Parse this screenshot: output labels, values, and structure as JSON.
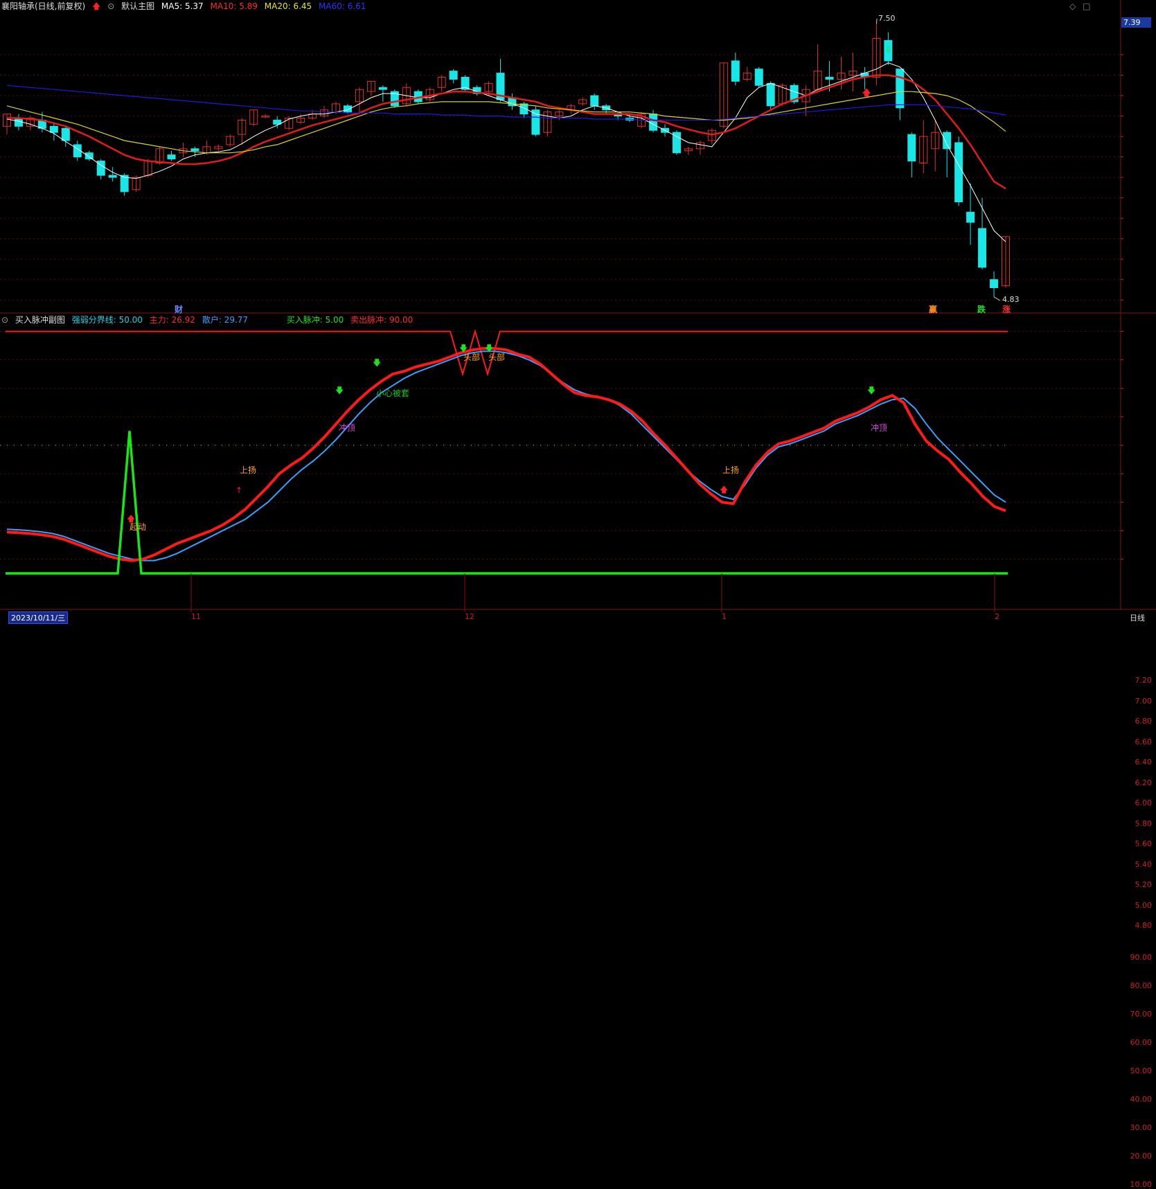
{
  "header_main": {
    "stock_title": "襄阳轴承(日线,前复权)",
    "indicator_name": "默认主图",
    "ma5": "MA5: 5.37",
    "ma10": "MA10: 5.89",
    "ma20": "MA20: 6.45",
    "ma60": "MA60: 6.61"
  },
  "header_sub": {
    "indicator_name": "买入脉冲副图",
    "divider_line": "强弱分界线: 50.00",
    "main_force": "主力: 26.92",
    "retail": "散户: 29.77",
    "buy_pulse": "买入脉冲: 5.00",
    "sell_pulse": "卖出脉冲: 90.00"
  },
  "price_axis": [
    "7.20",
    "7.00",
    "6.80",
    "6.60",
    "6.40",
    "6.20",
    "6.00",
    "5.80",
    "5.60",
    "5.40",
    "5.20",
    "5.00",
    "4.80"
  ],
  "osc_axis": [
    "90.00",
    "80.00",
    "70.00",
    "60.00",
    "50.00",
    "40.00",
    "30.00",
    "20.00",
    "10.00"
  ],
  "current_price_tag": "7.39",
  "high_label": "7.50",
  "low_label": "4.83",
  "markers": {
    "cai": "财",
    "ying": "赢",
    "die": "跌",
    "zhang": "涨"
  },
  "annotations": {
    "qidong": "起动",
    "shangyang1": "上扬",
    "chongding1": "冲顶",
    "xiaoxin": "小心被套",
    "toubu1": "头部",
    "toubu2": "头部",
    "shangyang2": "上扬",
    "chongding2": "冲顶"
  },
  "date_axis": {
    "start_date": "2023/10/11/三",
    "m11": "11",
    "m12": "12",
    "m1": "1",
    "m2": "2",
    "period": "日线"
  },
  "colors": {
    "ma5": "#ffffff",
    "ma10": "#e21b1b",
    "ma20": "#d8d81a",
    "ma60": "#1a1ae6",
    "up": "#e03030",
    "down": "#19e6e6",
    "main_force": "#ff1a1a",
    "retail": "#3aa0ff",
    "pulse": "#19e619"
  },
  "chart_data": {
    "type": "candlestick",
    "ylim": [
      4.7,
      7.6
    ],
    "candles": [
      [
        6.5,
        6.62,
        6.62,
        6.42
      ],
      [
        6.58,
        6.5,
        6.62,
        6.46
      ],
      [
        6.5,
        6.58,
        6.6,
        6.46
      ],
      [
        6.56,
        6.48,
        6.64,
        6.44
      ],
      [
        6.5,
        6.44,
        6.54,
        6.36
      ],
      [
        6.48,
        6.36,
        6.5,
        6.3
      ],
      [
        6.32,
        6.2,
        6.36,
        6.16
      ],
      [
        6.24,
        6.18,
        6.26,
        6.16
      ],
      [
        6.16,
        6.02,
        6.18,
        5.98
      ],
      [
        6.02,
        6.0,
        6.1,
        5.96
      ],
      [
        6.02,
        5.86,
        6.04,
        5.82
      ],
      [
        5.88,
        6.0,
        6.02,
        5.86
      ],
      [
        6.02,
        6.16,
        6.18,
        6.0
      ],
      [
        6.14,
        6.28,
        6.3,
        6.12
      ],
      [
        6.22,
        6.18,
        6.26,
        6.16
      ],
      [
        6.24,
        6.28,
        6.34,
        6.2
      ],
      [
        6.28,
        6.26,
        6.3,
        6.2
      ],
      [
        6.24,
        6.3,
        6.36,
        6.22
      ],
      [
        6.28,
        6.3,
        6.32,
        6.26
      ],
      [
        6.32,
        6.4,
        6.42,
        6.3
      ],
      [
        6.42,
        6.56,
        6.58,
        6.32
      ],
      [
        6.52,
        6.66,
        6.66,
        6.5
      ],
      [
        6.6,
        6.6,
        6.62,
        6.58
      ],
      [
        6.56,
        6.52,
        6.6,
        6.48
      ],
      [
        6.48,
        6.58,
        6.6,
        6.46
      ],
      [
        6.54,
        6.58,
        6.62,
        6.52
      ],
      [
        6.58,
        6.62,
        6.66,
        6.56
      ],
      [
        6.6,
        6.66,
        6.7,
        6.58
      ],
      [
        6.64,
        6.72,
        6.74,
        6.62
      ],
      [
        6.7,
        6.64,
        6.72,
        6.62
      ],
      [
        6.74,
        6.86,
        6.88,
        6.62
      ],
      [
        6.84,
        6.94,
        6.94,
        6.8
      ],
      [
        6.88,
        6.86,
        6.9,
        6.74
      ],
      [
        6.84,
        6.7,
        6.86,
        6.68
      ],
      [
        6.72,
        6.88,
        6.92,
        6.7
      ],
      [
        6.84,
        6.74,
        6.86,
        6.72
      ],
      [
        6.76,
        6.86,
        6.88,
        6.74
      ],
      [
        6.88,
        6.98,
        7.0,
        6.84
      ],
      [
        7.04,
        6.96,
        7.06,
        6.92
      ],
      [
        6.98,
        6.86,
        7.0,
        6.84
      ],
      [
        6.88,
        6.82,
        6.9,
        6.8
      ],
      [
        6.84,
        6.92,
        6.94,
        6.8
      ],
      [
        7.02,
        6.76,
        7.16,
        6.74
      ],
      [
        6.78,
        6.7,
        6.82,
        6.66
      ],
      [
        6.72,
        6.62,
        6.74,
        6.58
      ],
      [
        6.66,
        6.42,
        6.7,
        6.4
      ],
      [
        6.44,
        6.64,
        6.66,
        6.4
      ],
      [
        6.6,
        6.64,
        6.66,
        6.56
      ],
      [
        6.66,
        6.7,
        6.72,
        6.62
      ],
      [
        6.72,
        6.76,
        6.78,
        6.7
      ],
      [
        6.8,
        6.7,
        6.82,
        6.66
      ],
      [
        6.7,
        6.66,
        6.72,
        6.62
      ],
      [
        6.62,
        6.6,
        6.64,
        6.56
      ],
      [
        6.58,
        6.56,
        6.62,
        6.54
      ],
      [
        6.5,
        6.62,
        6.64,
        6.48
      ],
      [
        6.62,
        6.46,
        6.66,
        6.44
      ],
      [
        6.48,
        6.44,
        6.52,
        6.4
      ],
      [
        6.44,
        6.24,
        6.46,
        6.22
      ],
      [
        6.26,
        6.28,
        6.3,
        6.22
      ],
      [
        6.28,
        6.34,
        6.36,
        6.22
      ],
      [
        6.36,
        6.46,
        6.48,
        6.32
      ],
      [
        6.5,
        7.12,
        7.12,
        6.48
      ],
      [
        7.14,
        6.94,
        7.22,
        6.9
      ],
      [
        6.96,
        7.02,
        7.08,
        6.94
      ],
      [
        7.06,
        6.9,
        7.08,
        6.88
      ],
      [
        6.92,
        6.7,
        6.94,
        6.66
      ],
      [
        6.72,
        6.9,
        6.92,
        6.7
      ],
      [
        6.9,
        6.74,
        6.92,
        6.72
      ],
      [
        6.74,
        6.86,
        6.9,
        6.6
      ],
      [
        6.86,
        7.04,
        7.3,
        6.84
      ],
      [
        6.98,
        6.96,
        7.14,
        6.84
      ],
      [
        6.96,
        7.02,
        7.18,
        6.86
      ],
      [
        7.0,
        7.04,
        7.22,
        6.84
      ],
      [
        7.02,
        6.98,
        7.08,
        6.86
      ],
      [
        6.98,
        7.36,
        7.5,
        6.9
      ],
      [
        7.34,
        7.14,
        7.42,
        7.1
      ],
      [
        7.06,
        6.68,
        7.06,
        6.56
      ],
      [
        6.42,
        6.16,
        6.44,
        6.0
      ],
      [
        6.14,
        6.4,
        6.56,
        6.04
      ],
      [
        6.28,
        6.44,
        6.56,
        6.06
      ],
      [
        6.44,
        6.28,
        6.46,
        6.0
      ],
      [
        6.34,
        5.76,
        6.4,
        5.72
      ],
      [
        5.66,
        5.56,
        5.94,
        5.34
      ],
      [
        5.5,
        5.12,
        5.8,
        5.1
      ],
      [
        5.0,
        4.92,
        5.08,
        4.83
      ],
      [
        4.94,
        5.42,
        5.42,
        4.92
      ]
    ],
    "ma_series": [
      {
        "name": "MA5",
        "values": [
          6.57,
          6.55,
          6.52,
          6.48,
          6.43,
          6.35,
          6.28,
          6.2,
          6.12,
          6.05,
          6.0,
          5.99,
          6.02,
          6.06,
          6.11,
          6.18,
          6.22,
          6.24,
          6.25,
          6.27,
          6.33,
          6.4,
          6.46,
          6.51,
          6.57,
          6.6,
          6.62,
          6.62,
          6.64,
          6.66,
          6.72,
          6.78,
          6.82,
          6.82,
          6.8,
          6.78,
          6.78,
          6.82,
          6.86,
          6.88,
          6.84,
          6.8,
          6.76,
          6.72,
          6.68,
          6.62,
          6.6,
          6.58,
          6.6,
          6.66,
          6.7,
          6.68,
          6.64,
          6.6,
          6.58,
          6.52,
          6.46,
          6.4,
          6.34,
          6.32,
          6.3,
          6.44,
          6.58,
          6.78,
          6.88,
          6.92,
          6.88,
          6.84,
          6.8,
          6.86,
          6.9,
          6.94,
          6.98,
          7.02,
          7.06,
          7.12,
          7.08,
          6.96,
          6.78,
          6.56,
          6.32,
          6.12,
          5.92,
          5.7,
          5.48,
          5.37
        ]
      },
      {
        "name": "MA10",
        "values": [
          6.58,
          6.58,
          6.57,
          6.56,
          6.53,
          6.5,
          6.45,
          6.4,
          6.34,
          6.28,
          6.22,
          6.18,
          6.16,
          6.15,
          6.14,
          6.13,
          6.13,
          6.14,
          6.16,
          6.19,
          6.24,
          6.3,
          6.35,
          6.39,
          6.43,
          6.47,
          6.51,
          6.54,
          6.57,
          6.6,
          6.63,
          6.68,
          6.72,
          6.74,
          6.76,
          6.78,
          6.8,
          6.82,
          6.84,
          6.84,
          6.83,
          6.82,
          6.8,
          6.78,
          6.76,
          6.74,
          6.7,
          6.68,
          6.66,
          6.64,
          6.62,
          6.62,
          6.62,
          6.62,
          6.6,
          6.56,
          6.54,
          6.5,
          6.47,
          6.44,
          6.42,
          6.44,
          6.48,
          6.54,
          6.6,
          6.66,
          6.72,
          6.76,
          6.8,
          6.84,
          6.88,
          6.92,
          6.96,
          6.98,
          7.0,
          7.0,
          6.98,
          6.94,
          6.86,
          6.76,
          6.62,
          6.48,
          6.32,
          6.14,
          5.96,
          5.89
        ]
      },
      {
        "name": "MA20",
        "values": [
          6.7,
          6.67,
          6.64,
          6.61,
          6.58,
          6.55,
          6.52,
          6.48,
          6.44,
          6.4,
          6.36,
          6.34,
          6.32,
          6.3,
          6.28,
          6.26,
          6.25,
          6.24,
          6.24,
          6.24,
          6.25,
          6.27,
          6.3,
          6.32,
          6.36,
          6.4,
          6.44,
          6.48,
          6.52,
          6.56,
          6.6,
          6.64,
          6.67,
          6.69,
          6.7,
          6.72,
          6.73,
          6.74,
          6.74,
          6.74,
          6.74,
          6.74,
          6.73,
          6.72,
          6.71,
          6.7,
          6.68,
          6.67,
          6.66,
          6.65,
          6.64,
          6.64,
          6.64,
          6.64,
          6.63,
          6.62,
          6.6,
          6.59,
          6.58,
          6.57,
          6.56,
          6.56,
          6.57,
          6.58,
          6.6,
          6.62,
          6.64,
          6.66,
          6.68,
          6.7,
          6.72,
          6.74,
          6.76,
          6.78,
          6.8,
          6.82,
          6.84,
          6.84,
          6.83,
          6.82,
          6.8,
          6.76,
          6.7,
          6.62,
          6.54,
          6.45
        ]
      },
      {
        "name": "MA60",
        "values": [
          6.9,
          6.89,
          6.88,
          6.87,
          6.86,
          6.85,
          6.84,
          6.83,
          6.82,
          6.81,
          6.8,
          6.79,
          6.78,
          6.77,
          6.76,
          6.75,
          6.74,
          6.73,
          6.72,
          6.71,
          6.7,
          6.69,
          6.68,
          6.67,
          6.66,
          6.65,
          6.65,
          6.64,
          6.64,
          6.63,
          6.63,
          6.63,
          6.63,
          6.62,
          6.62,
          6.62,
          6.62,
          6.61,
          6.61,
          6.61,
          6.6,
          6.6,
          6.6,
          6.59,
          6.59,
          6.59,
          6.58,
          6.58,
          6.58,
          6.58,
          6.57,
          6.57,
          6.57,
          6.57,
          6.56,
          6.56,
          6.56,
          6.56,
          6.56,
          6.56,
          6.56,
          6.57,
          6.58,
          6.59,
          6.6,
          6.61,
          6.62,
          6.63,
          6.64,
          6.65,
          6.66,
          6.67,
          6.68,
          6.69,
          6.7,
          6.71,
          6.71,
          6.71,
          6.71,
          6.7,
          6.69,
          6.68,
          6.67,
          6.65,
          6.63,
          6.61
        ]
      }
    ],
    "oscillator": {
      "ylim": [
        5,
        95
      ],
      "main_force": [
        19.5,
        19.3,
        19.0,
        18.6,
        18.0,
        17.0,
        15.5,
        14.0,
        12.5,
        11.0,
        10.0,
        9.5,
        10.0,
        11.5,
        13.5,
        15.5,
        17.0,
        18.5,
        20.0,
        22.0,
        24.5,
        27.5,
        31.5,
        35.5,
        40.0,
        43.0,
        45.5,
        49.0,
        53.0,
        57.5,
        62.0,
        66.0,
        69.5,
        72.5,
        75.0,
        76.0,
        77.5,
        78.5,
        79.5,
        81.0,
        82.5,
        83.5,
        84.0,
        84.0,
        83.5,
        82.0,
        81.0,
        78.5,
        75.0,
        71.5,
        68.5,
        67.5,
        67.0,
        66.0,
        64.5,
        62.0,
        58.5,
        54.0,
        50.0,
        45.5,
        41.0,
        36.5,
        33.0,
        30.0,
        29.5,
        37.0,
        43.0,
        47.5,
        50.5,
        51.5,
        53.0,
        54.5,
        56.0,
        58.5,
        60.0,
        61.5,
        63.5,
        66.0,
        67.5,
        65.0,
        57.5,
        51.5,
        48.0,
        45.0,
        40.5,
        36.5,
        32.0,
        28.5,
        27.0
      ],
      "retail": [
        20.5,
        20.3,
        20.0,
        19.6,
        19.0,
        18.0,
        16.5,
        15.0,
        13.5,
        12.0,
        11.0,
        10.0,
        9.5,
        9.5,
        10.5,
        12.0,
        14.0,
        16.0,
        18.0,
        20.0,
        22.0,
        24.0,
        27.0,
        30.0,
        34.0,
        38.0,
        41.5,
        44.5,
        48.0,
        52.0,
        56.5,
        61.0,
        65.0,
        68.5,
        71.0,
        73.5,
        75.5,
        77.0,
        78.5,
        80.0,
        81.5,
        82.5,
        83.0,
        83.0,
        82.5,
        81.5,
        80.0,
        78.0,
        75.0,
        72.0,
        69.5,
        68.0,
        67.0,
        66.0,
        64.0,
        61.0,
        57.0,
        53.0,
        49.0,
        45.0,
        41.0,
        37.5,
        34.5,
        32.0,
        31.0,
        36.0,
        42.0,
        46.5,
        49.5,
        50.5,
        52.0,
        53.5,
        55.0,
        57.5,
        59.0,
        60.5,
        62.5,
        64.5,
        66.0,
        66.5,
        63.0,
        57.5,
        52.5,
        48.5,
        44.5,
        40.5,
        36.5,
        32.5,
        30.0
      ],
      "pulse": [
        5,
        5,
        5,
        5,
        5,
        5,
        5,
        5,
        5,
        5,
        5,
        5,
        55,
        5,
        5,
        5,
        5,
        5,
        5,
        5,
        5,
        5,
        5,
        5,
        5,
        5,
        5,
        5,
        5,
        5,
        5,
        5,
        5,
        5,
        5,
        5,
        5,
        5,
        5,
        5,
        5,
        5,
        5,
        5,
        5,
        5,
        5,
        5,
        5,
        5,
        5,
        5,
        5,
        5,
        5,
        5,
        5,
        5,
        5,
        5,
        5,
        5,
        5,
        5,
        5,
        5,
        5,
        5,
        5,
        5,
        5,
        5,
        5,
        5,
        5,
        5,
        5,
        5,
        5,
        5,
        5,
        5,
        5,
        5,
        5,
        5,
        5,
        5,
        5
      ],
      "sell_line": 90,
      "divider": 50
    }
  }
}
